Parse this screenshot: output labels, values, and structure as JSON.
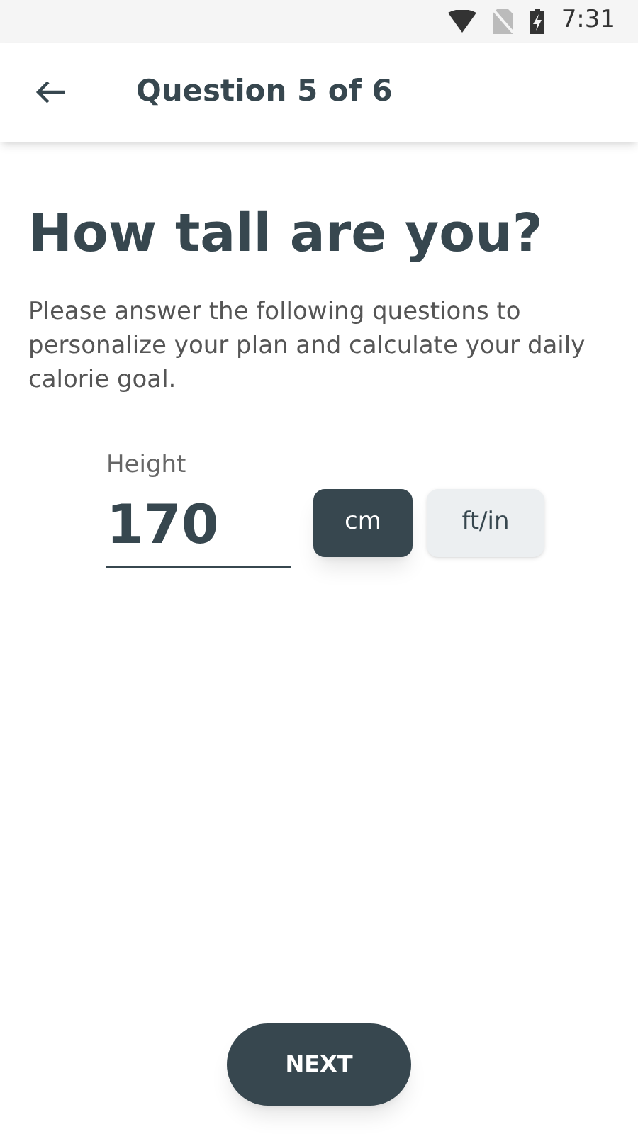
{
  "status_bar": {
    "time": "7:31"
  },
  "app_bar": {
    "title": "Question 5 of 6"
  },
  "heading": "How tall are you?",
  "description": "Please answer the following questions to personalize your plan and calculate your daily calorie goal.",
  "height_field": {
    "label": "Height",
    "value": "170"
  },
  "units": [
    {
      "label": "cm",
      "selected": true
    },
    {
      "label": "ft/in",
      "selected": false
    }
  ],
  "next_button": "NEXT"
}
